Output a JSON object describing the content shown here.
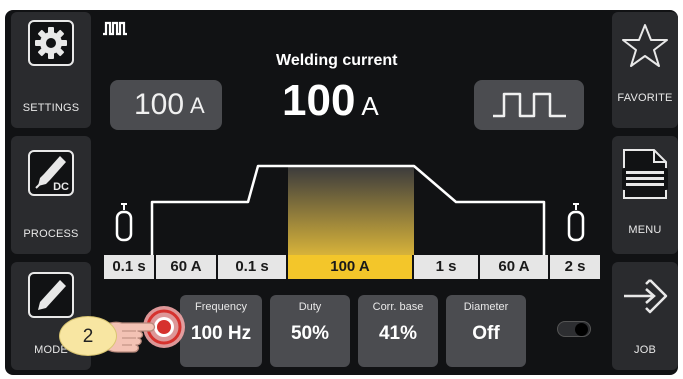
{
  "left_sidebar": [
    {
      "label": "SETTINGS",
      "icon": "gear-icon"
    },
    {
      "label": "PROCESS",
      "icon": "torch-dc-icon",
      "icon_text": "DC"
    },
    {
      "label": "MODE",
      "icon": "pen-icon"
    }
  ],
  "right_sidebar": [
    {
      "label": "FAVORITE",
      "icon": "star-icon"
    },
    {
      "label": "MENU",
      "icon": "document-menu-icon"
    },
    {
      "label": "JOB",
      "icon": "arrow-diamond-icon"
    }
  ],
  "header": {
    "mode_icon": "pulse-mode-icon",
    "title": "Welding current",
    "value": "100",
    "unit": "A"
  },
  "left_pill": {
    "value": "100",
    "unit": "A"
  },
  "right_pill": {
    "icon": "pulse-waveform-icon"
  },
  "timeline": [
    {
      "label": "0.1 s",
      "active": false
    },
    {
      "label": "60 A",
      "active": false
    },
    {
      "label": "0.1 s",
      "active": false
    },
    {
      "label": "100 A",
      "active": true
    },
    {
      "label": "1 s",
      "active": false
    },
    {
      "label": "60 A",
      "active": false
    },
    {
      "label": "2 s",
      "active": false
    }
  ],
  "params": [
    {
      "label": "Frequency",
      "value": "100 Hz"
    },
    {
      "label": "Duty",
      "value": "50%"
    },
    {
      "label": "Corr. base",
      "value": "41%"
    },
    {
      "label": "Diameter",
      "value": "Off"
    }
  ],
  "callout": {
    "number": "2"
  },
  "colors": {
    "accent": "#f3c62a",
    "panel": "#111214",
    "button": "#2a2b2e",
    "pill": "#4b4c50"
  }
}
